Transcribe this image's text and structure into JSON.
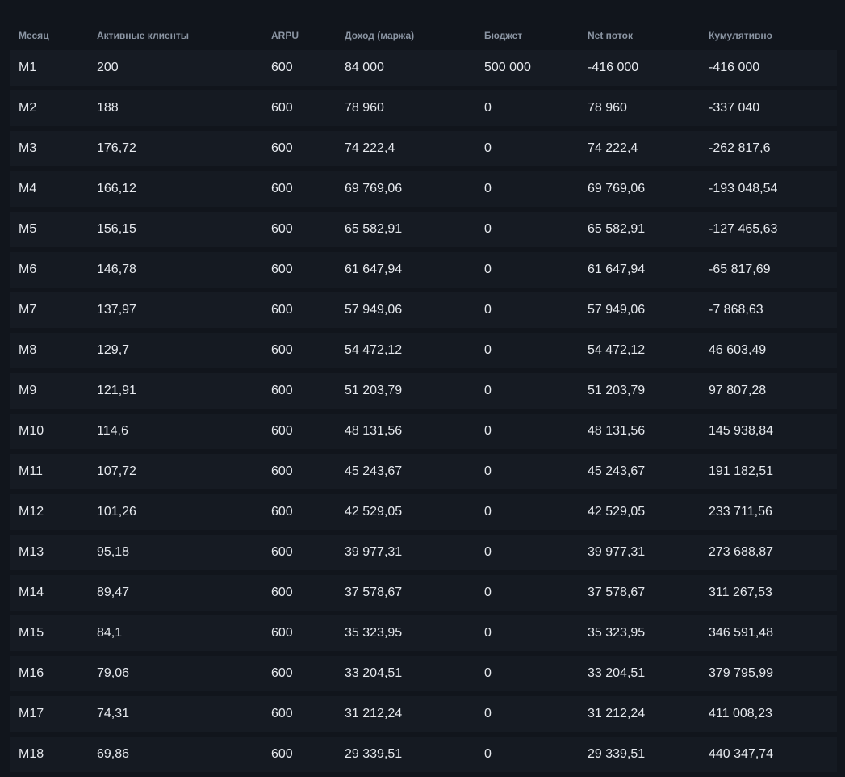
{
  "table": {
    "headers": [
      "Месяц",
      "Активные клиенты",
      "ARPU",
      "Доход (маржа)",
      "Бюджет",
      "Net поток",
      "Кумулятивно"
    ],
    "rows": [
      [
        "M1",
        "200",
        "600",
        "84 000",
        "500 000",
        "-416 000",
        "-416 000"
      ],
      [
        "M2",
        "188",
        "600",
        "78 960",
        "0",
        "78 960",
        "-337 040"
      ],
      [
        "M3",
        "176,72",
        "600",
        "74 222,4",
        "0",
        "74 222,4",
        "-262 817,6"
      ],
      [
        "M4",
        "166,12",
        "600",
        "69 769,06",
        "0",
        "69 769,06",
        "-193 048,54"
      ],
      [
        "M5",
        "156,15",
        "600",
        "65 582,91",
        "0",
        "65 582,91",
        "-127 465,63"
      ],
      [
        "M6",
        "146,78",
        "600",
        "61 647,94",
        "0",
        "61 647,94",
        "-65 817,69"
      ],
      [
        "M7",
        "137,97",
        "600",
        "57 949,06",
        "0",
        "57 949,06",
        "-7 868,63"
      ],
      [
        "M8",
        "129,7",
        "600",
        "54 472,12",
        "0",
        "54 472,12",
        "46 603,49"
      ],
      [
        "M9",
        "121,91",
        "600",
        "51 203,79",
        "0",
        "51 203,79",
        "97 807,28"
      ],
      [
        "M10",
        "114,6",
        "600",
        "48 131,56",
        "0",
        "48 131,56",
        "145 938,84"
      ],
      [
        "M11",
        "107,72",
        "600",
        "45 243,67",
        "0",
        "45 243,67",
        "191 182,51"
      ],
      [
        "M12",
        "101,26",
        "600",
        "42 529,05",
        "0",
        "42 529,05",
        "233 711,56"
      ],
      [
        "M13",
        "95,18",
        "600",
        "39 977,31",
        "0",
        "39 977,31",
        "273 688,87"
      ],
      [
        "M14",
        "89,47",
        "600",
        "37 578,67",
        "0",
        "37 578,67",
        "311 267,53"
      ],
      [
        "M15",
        "84,1",
        "600",
        "35 323,95",
        "0",
        "35 323,95",
        "346 591,48"
      ],
      [
        "M16",
        "79,06",
        "600",
        "33 204,51",
        "0",
        "33 204,51",
        "379 795,99"
      ],
      [
        "M17",
        "74,31",
        "600",
        "31 212,24",
        "0",
        "31 212,24",
        "411 008,23"
      ],
      [
        "M18",
        "69,86",
        "600",
        "29 339,51",
        "0",
        "29 339,51",
        "440 347,74"
      ]
    ]
  },
  "colors": {
    "background": "#11151c",
    "row_background": "#161b23",
    "header_text": "#8b95a3",
    "body_text": "#e6e9ee"
  }
}
